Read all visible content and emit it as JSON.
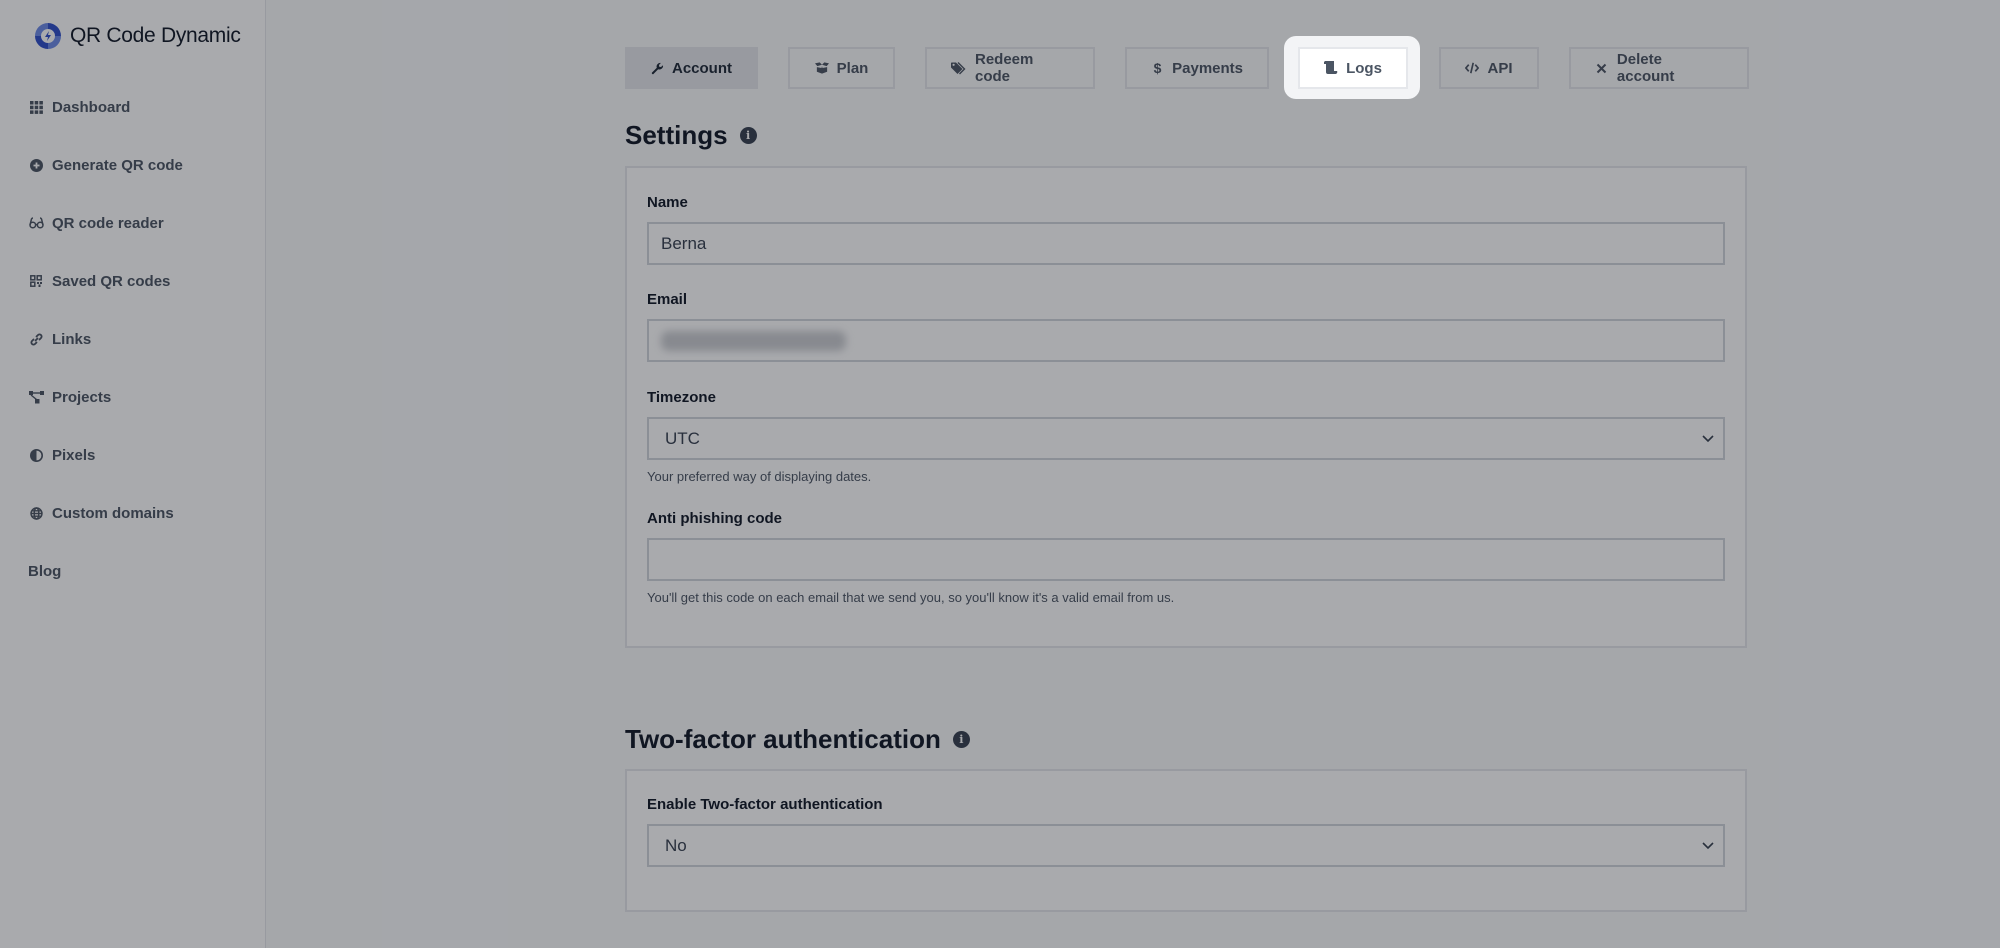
{
  "brand": {
    "name": "QR Code Dynamic",
    "color": "#2f4fc9"
  },
  "sidebar": {
    "items": [
      {
        "label": "Dashboard",
        "icon": "grid-icon"
      },
      {
        "label": "Generate QR code",
        "icon": "plus-circle-icon"
      },
      {
        "label": "QR code reader",
        "icon": "glasses-icon"
      },
      {
        "label": "Saved QR codes",
        "icon": "qrcode-icon"
      },
      {
        "label": "Links",
        "icon": "link-icon"
      },
      {
        "label": "Projects",
        "icon": "project-diagram-icon"
      },
      {
        "label": "Pixels",
        "icon": "adjust-icon"
      },
      {
        "label": "Custom domains",
        "icon": "globe-icon"
      },
      {
        "label": "Blog",
        "icon": ""
      }
    ]
  },
  "tabs": [
    {
      "label": "Account",
      "icon": "wrench-icon",
      "active": true
    },
    {
      "label": "Plan",
      "icon": "box-open-icon"
    },
    {
      "label": "Redeem code",
      "icon": "tags-icon"
    },
    {
      "label": "Payments",
      "icon": "dollar-icon"
    },
    {
      "label": "Logs",
      "icon": "scroll-icon",
      "highlighted": true
    },
    {
      "label": "API",
      "icon": "code-icon"
    },
    {
      "label": "Delete account",
      "icon": "times-icon"
    }
  ],
  "settings": {
    "title": "Settings",
    "name": {
      "label": "Name",
      "value": "Berna"
    },
    "email": {
      "label": "Email",
      "value": ""
    },
    "timezone": {
      "label": "Timezone",
      "value": "UTC",
      "help": "Your preferred way of displaying dates."
    },
    "anti_phishing": {
      "label": "Anti phishing code",
      "value": "",
      "help": "You'll get this code on each email that we send you, so you'll know it's a valid email from us."
    }
  },
  "two_factor": {
    "title": "Two-factor authentication",
    "enable": {
      "label": "Enable Two-factor authentication",
      "value": "No"
    }
  }
}
